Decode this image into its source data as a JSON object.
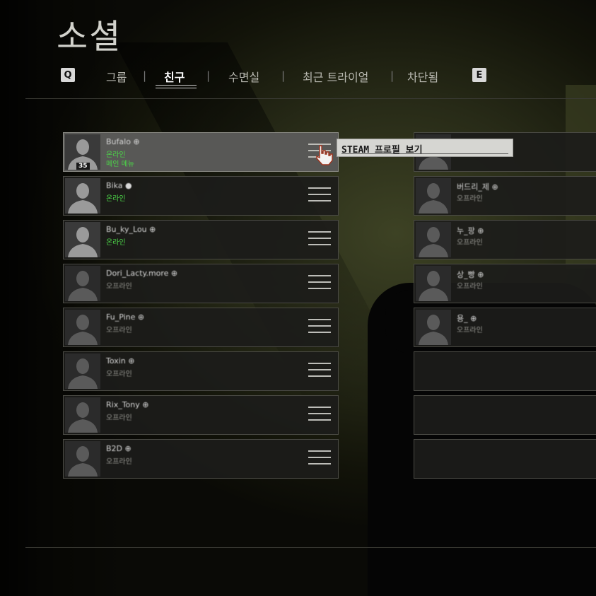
{
  "title": "소셜",
  "nav": {
    "left_key": "Q",
    "right_key": "E",
    "tabs": [
      {
        "label": "그룹"
      },
      {
        "label": "친구"
      },
      {
        "label": "수면실"
      },
      {
        "label": "최근 트라이얼"
      },
      {
        "label": "차단됨"
      }
    ],
    "separator": "|"
  },
  "tooltip": "STEAM 프로필 보기",
  "friends_left": [
    {
      "name": "Bufalo ⊕",
      "status": "온라인",
      "status_state": "online",
      "sub_status": "메인 메뉴",
      "level": "35"
    },
    {
      "name": "Bika ●",
      "status": "온라인",
      "status_state": "online"
    },
    {
      "name": "Bu_ky_Lou ⊕",
      "status": "온라인",
      "status_state": "online"
    },
    {
      "name": "Dori_Lacty.more ⊕",
      "status": "오프라인",
      "status_state": "offline"
    },
    {
      "name": "Fu_Pine ⊕",
      "status": "오프라인",
      "status_state": "offline"
    },
    {
      "name": "Toxin ⊕",
      "status": "오프라인",
      "status_state": "offline"
    },
    {
      "name": "Rix_Tony ⊕",
      "status": "오프라인",
      "status_state": "offline"
    },
    {
      "name": "B2D ⊕",
      "status": "오프라인",
      "status_state": "offline"
    }
  ],
  "friends_right": [
    {
      "name": "",
      "status": ""
    },
    {
      "name": "버드리_제 ⊕",
      "status": "오프라인"
    },
    {
      "name": "누_팡 ⊕",
      "status": "오프라인"
    },
    {
      "name": "상_빵 ⊕",
      "status": "오프라인"
    },
    {
      "name": "용_ ⊕",
      "status": "오프라인"
    },
    {
      "name": "",
      "status": ""
    },
    {
      "name": "",
      "status": ""
    },
    {
      "name": "",
      "status": ""
    }
  ]
}
